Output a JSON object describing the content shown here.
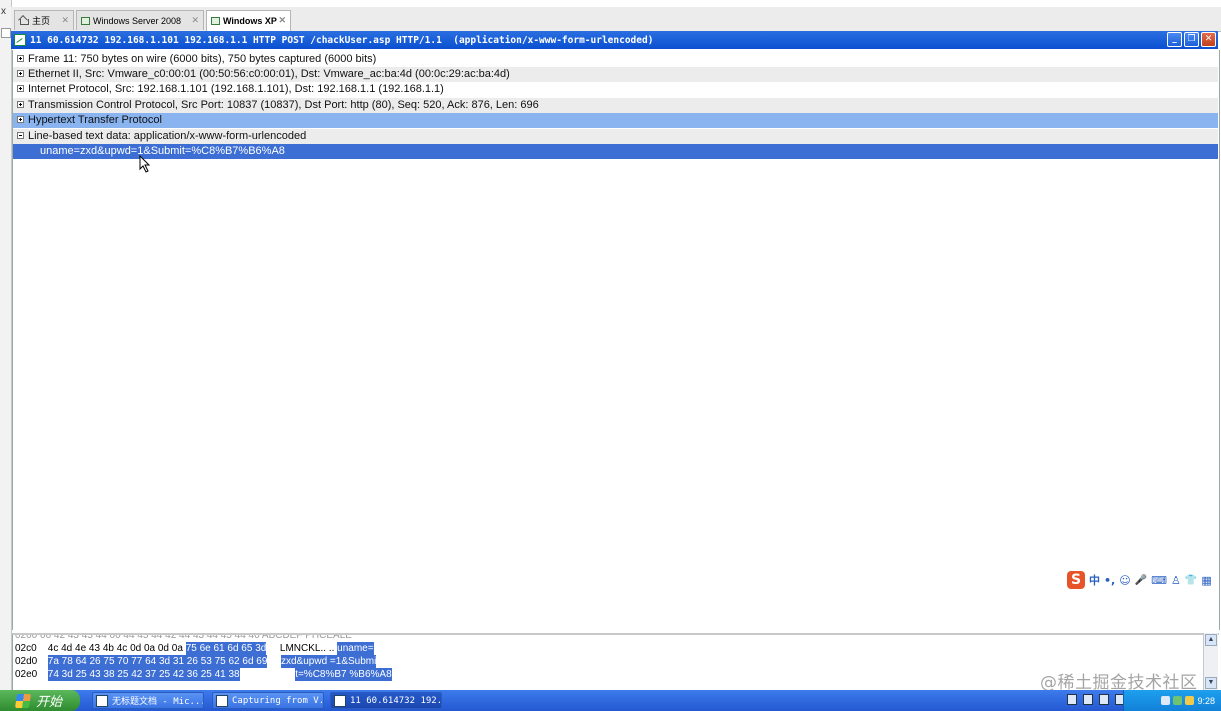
{
  "tabs": [
    {
      "label": "主页",
      "icon": "home-icon"
    },
    {
      "label": "Windows Server 2008",
      "icon": "vm-icon"
    },
    {
      "label": "Windows XP",
      "icon": "vm-icon",
      "active": true
    }
  ],
  "window": {
    "title": "11 60.614732 192.168.1.101 192.168.1.1 HTTP POST /chackUser.asp HTTP/1.1  (application/x-www-form-urlencoded)"
  },
  "tree": [
    {
      "text": "Frame 11: 750 bytes on wire (6000 bits), 750 bytes captured (6000 bits)",
      "expanded": false,
      "style": ""
    },
    {
      "text": "Ethernet II, Src: Vmware_c0:00:01 (00:50:56:c0:00:01), Dst: Vmware_ac:ba:4d (00:0c:29:ac:ba:4d)",
      "expanded": false,
      "style": "shade"
    },
    {
      "text": "Internet Protocol, Src: 192.168.1.101 (192.168.1.101), Dst: 192.168.1.1 (192.168.1.1)",
      "expanded": false,
      "style": ""
    },
    {
      "text": "Transmission Control Protocol, Src Port: 10837 (10837), Dst Port: http (80), Seq: 520, Ack: 876, Len: 696",
      "expanded": false,
      "style": "shade"
    },
    {
      "text": "Hypertext Transfer Protocol",
      "expanded": false,
      "style": "hl"
    },
    {
      "text": "Line-based text data: application/x-www-form-urlencoded",
      "expanded": true,
      "style": "shade"
    },
    {
      "text": "uname=zxd&upwd=1&Submit=%C8%B7%B6%A8",
      "expanded": null,
      "style": "sel",
      "child": true
    }
  ],
  "ime": {
    "logo": "S",
    "mode": "中",
    "punct": "•,",
    "smile": "☺",
    "mic": "🎤",
    "kbd": "⌨",
    "user": "♙",
    "shirt": "👕",
    "grid": "▦"
  },
  "bytes": [
    {
      "offset": "02c0",
      "hex_plain": "4c 4d 4e 43 4b 4c 0d 0a  0d 0a",
      "hex_sel": "75 6e 61 6d 65 3d",
      "ascii_plain": "LMNCKL.. ..",
      "ascii_sel": "uname="
    },
    {
      "offset": "02d0",
      "hex_plain": "",
      "hex_sel": "7a 78 64 26 75 70 77 64  3d 31 26 53 75 62 6d 69",
      "ascii_plain": "",
      "ascii_sel": "zxd&upwd =1&Submi"
    },
    {
      "offset": "02e0",
      "hex_plain": "",
      "hex_sel": "74 3d 25 43 38 25 42 37  25 42 36 25 41 38",
      "ascii_plain": "",
      "ascii_sel": "t=%C8%B7 %B6%A8"
    }
  ],
  "watermark": "@稀土掘金技术社区",
  "taskbar": {
    "start_label": "开始",
    "buttons": [
      {
        "label": "无标题文档 - Mic...",
        "active": false
      },
      {
        "label": "Capturing from V...",
        "active": false
      },
      {
        "label": "11 60.614732 192...",
        "active": true
      }
    ],
    "clock": "9:28"
  },
  "colors": {
    "title_bar": "#0a4fd0",
    "selection": "#3c6ed4",
    "highlight": "#8ab4f0",
    "taskbar": "#2458d2"
  }
}
